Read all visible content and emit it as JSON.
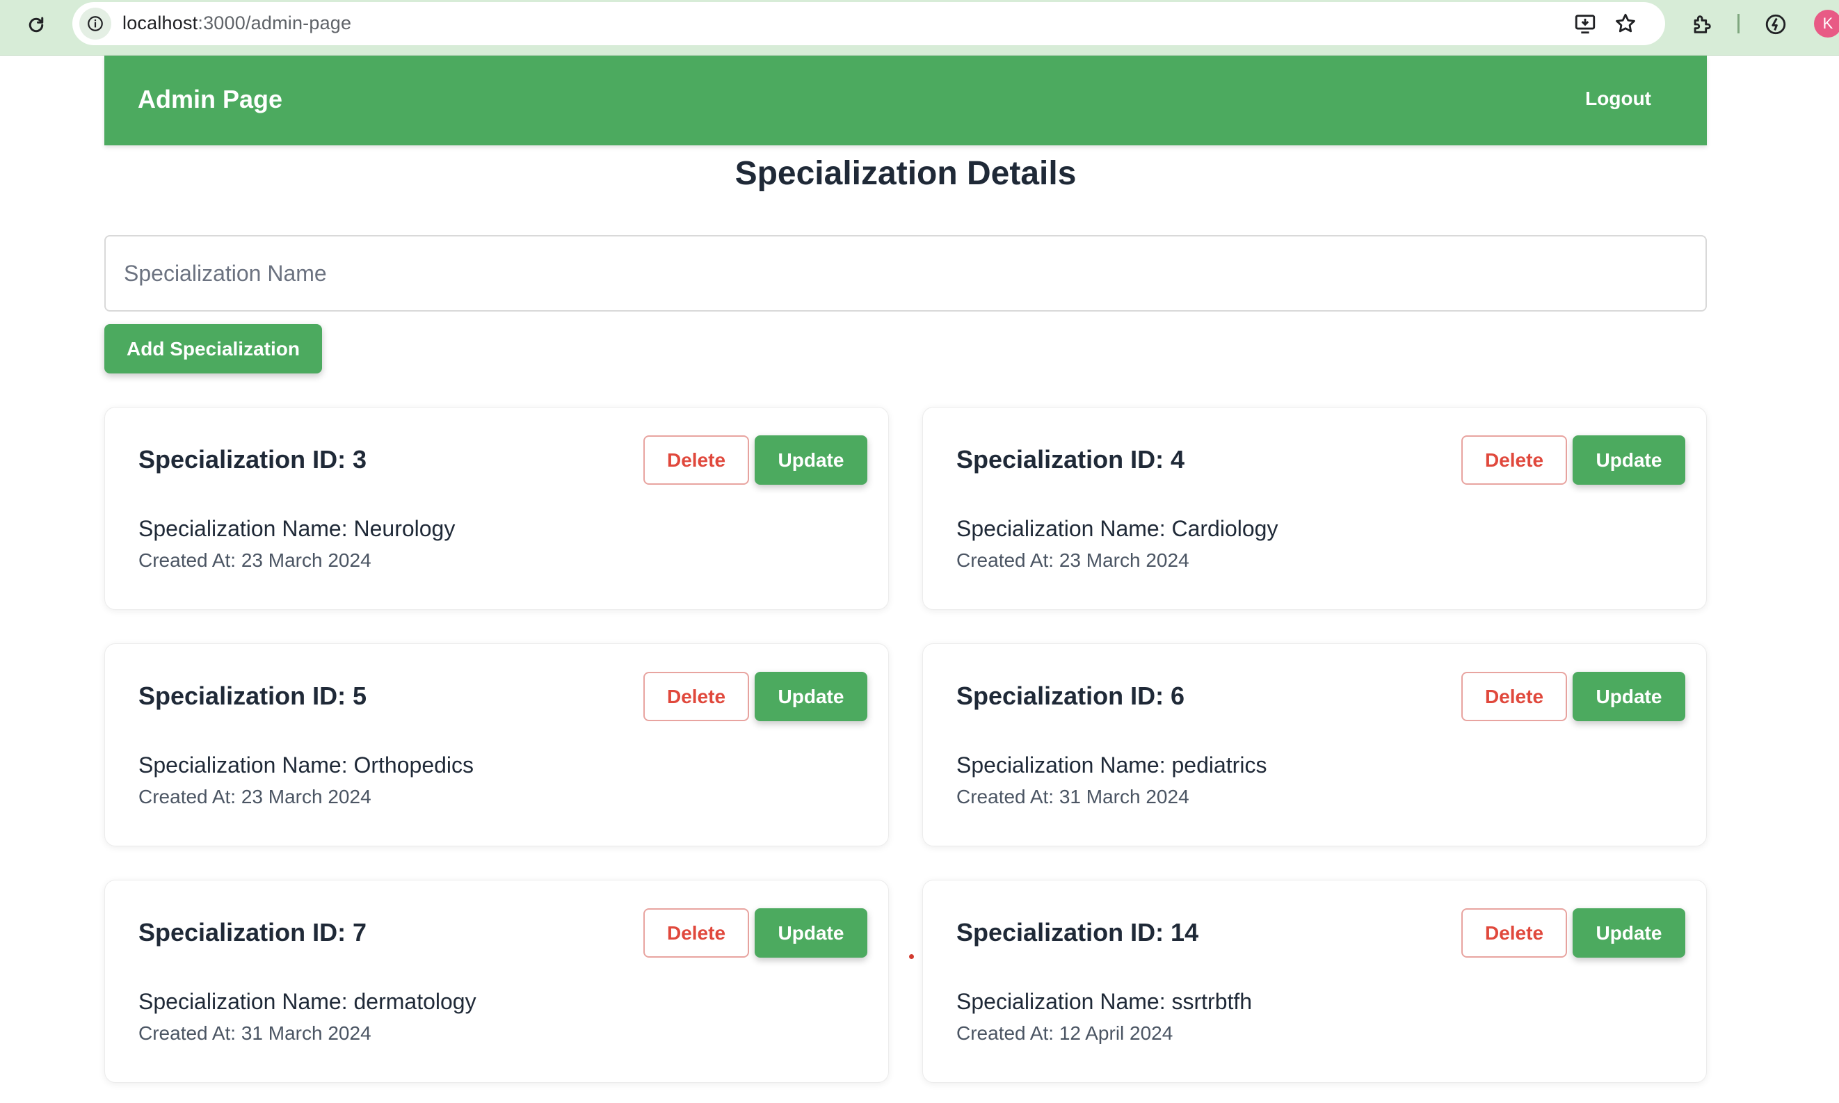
{
  "browser": {
    "url_host": "localhost",
    "url_path": ":3000/admin-page",
    "profile_initial": "K",
    "icons": [
      "reload-icon",
      "site-info-icon",
      "install-app-icon",
      "bookmark-star-icon",
      "extensions-icon",
      "performance-icon"
    ]
  },
  "header": {
    "title": "Admin Page",
    "logout_label": "Logout"
  },
  "page": {
    "title": "Specialization Details"
  },
  "form": {
    "input_placeholder": "Specialization Name",
    "input_value": "",
    "add_label": "Add Specialization"
  },
  "cards": [
    {
      "id_text": "Specialization ID: 3",
      "name_text": "Specialization Name: Neurology",
      "created_text": "Created At: 23 March 2024",
      "delete_label": "Delete",
      "update_label": "Update"
    },
    {
      "id_text": "Specialization ID: 4",
      "name_text": "Specialization Name: Cardiology",
      "created_text": "Created At: 23 March 2024",
      "delete_label": "Delete",
      "update_label": "Update"
    },
    {
      "id_text": "Specialization ID: 5",
      "name_text": "Specialization Name: Orthopedics",
      "created_text": "Created At: 23 March 2024",
      "delete_label": "Delete",
      "update_label": "Update"
    },
    {
      "id_text": "Specialization ID: 6",
      "name_text": "Specialization Name: pediatrics",
      "created_text": "Created At: 31 March 2024",
      "delete_label": "Delete",
      "update_label": "Update"
    },
    {
      "id_text": "Specialization ID: 7",
      "name_text": "Specialization Name: dermatology",
      "created_text": "Created At: 31 March 2024",
      "delete_label": "Delete",
      "update_label": "Update"
    },
    {
      "id_text": "Specialization ID: 14",
      "name_text": "Specialization Name: ssrtrbtfh",
      "created_text": "Created At: 12 April 2024",
      "delete_label": "Delete",
      "update_label": "Update"
    }
  ],
  "colors": {
    "accent_green": "#4caa5f",
    "delete_red": "#e0483c",
    "chrome_bg": "#d7ecd7"
  }
}
